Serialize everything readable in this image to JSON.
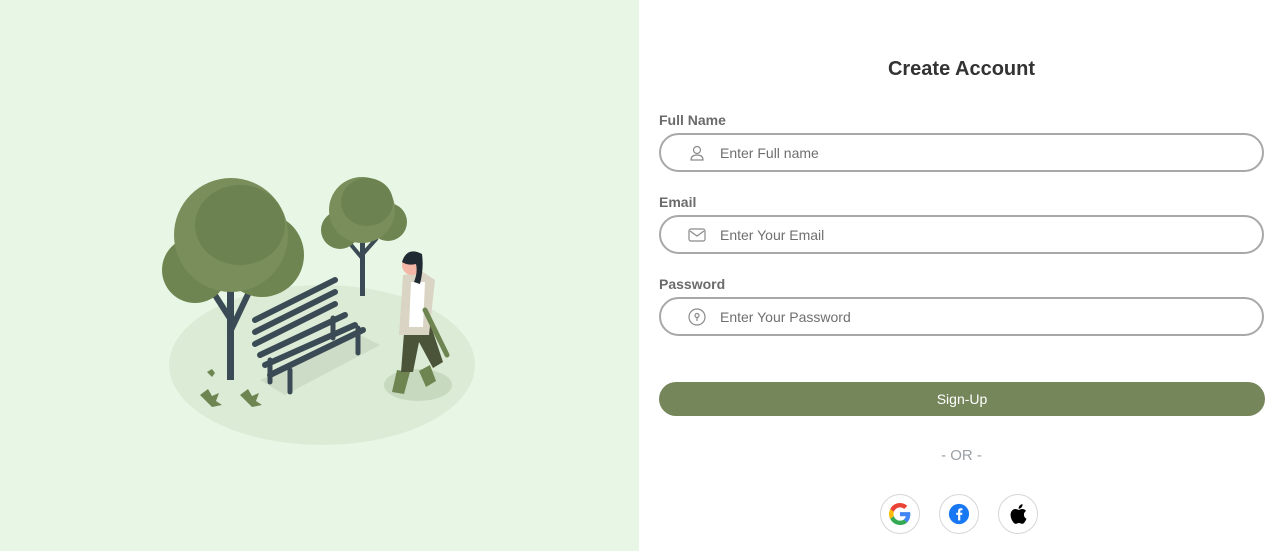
{
  "form": {
    "title": "Create Account",
    "full_name": {
      "label": "Full Name",
      "placeholder": "Enter Full name",
      "value": "",
      "icon": "user-icon"
    },
    "email": {
      "label": "Email",
      "placeholder": "Enter Your Email",
      "value": "",
      "icon": "envelope-icon"
    },
    "password": {
      "label": "Password",
      "placeholder": "Enter Your Password",
      "value": "",
      "icon": "lock-icon"
    },
    "signup_label": "Sign-Up",
    "or_text": "- OR -",
    "social": [
      {
        "icon": "google-icon"
      },
      {
        "icon": "facebook-icon"
      },
      {
        "icon": "apple-icon"
      }
    ]
  },
  "colors": {
    "left_background": "#e8f7e5",
    "accent": "#76865b",
    "border": "#a8a8a8",
    "title": "#333333",
    "label": "#6b6b6b"
  },
  "illustration": {
    "icon": "park-bench-woman-illustration"
  }
}
